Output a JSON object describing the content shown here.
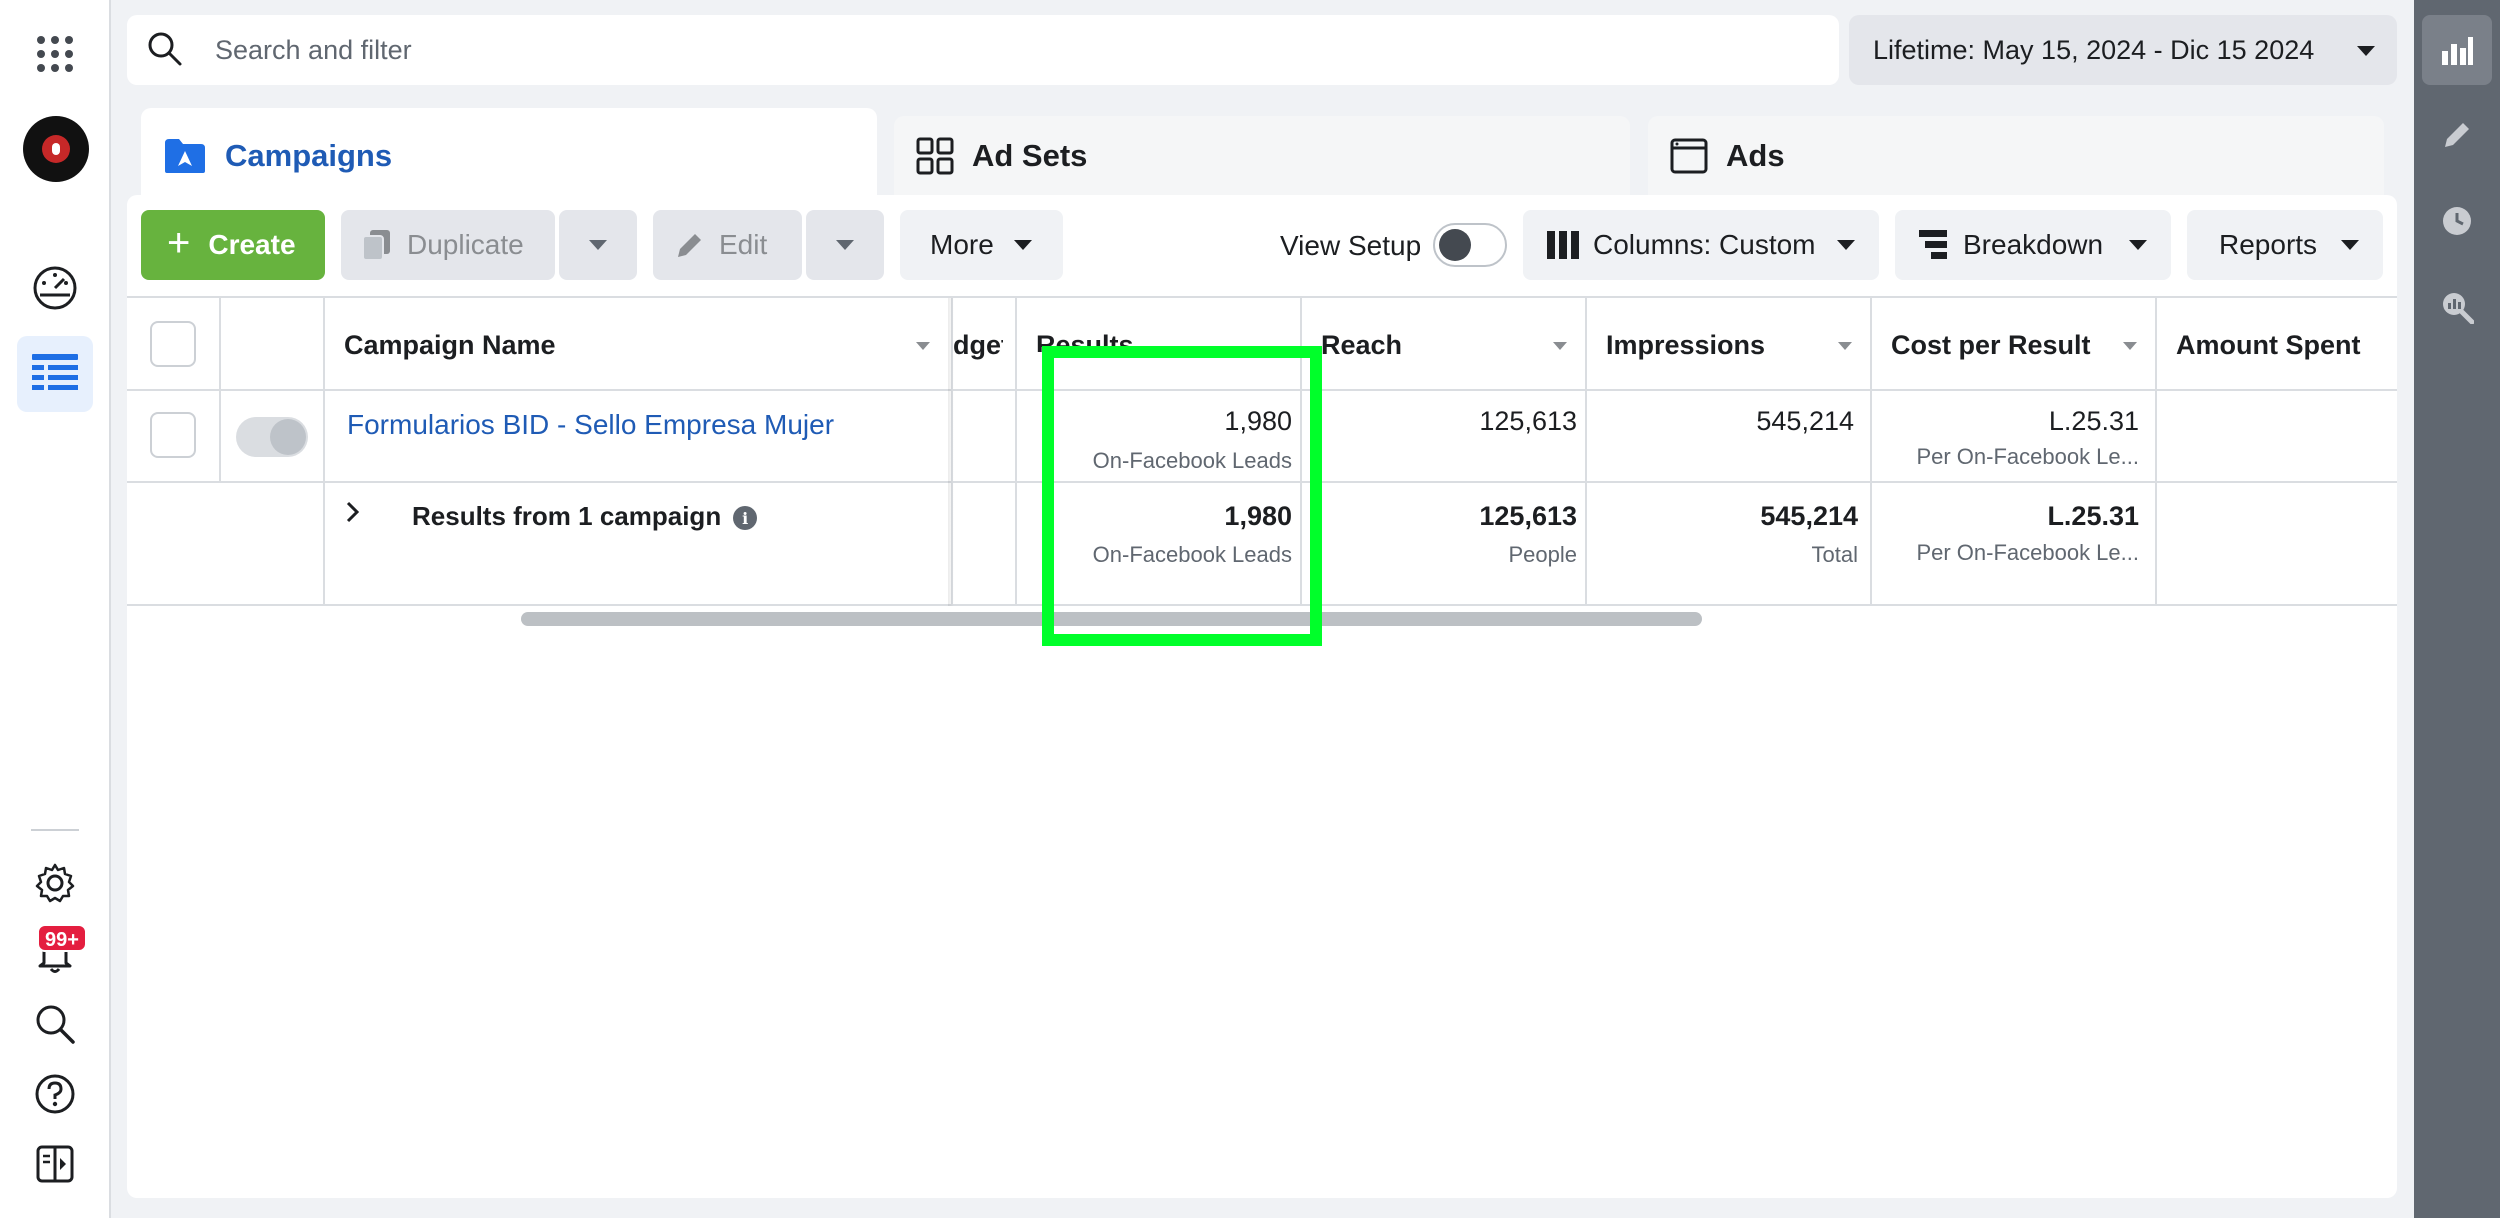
{
  "search": {
    "placeholder": "Search and filter"
  },
  "date_range": {
    "label": "Lifetime: May 15, 2024 - Dic 15 2024"
  },
  "tabs": [
    {
      "label": "Campaigns",
      "icon": "folder-icon",
      "active": true
    },
    {
      "label": "Ad Sets",
      "icon": "grid-icon",
      "active": false
    },
    {
      "label": "Ads",
      "icon": "window-icon",
      "active": false
    }
  ],
  "toolbar": {
    "create": "Create",
    "duplicate": "Duplicate",
    "edit": "Edit",
    "more": "More",
    "view_setup": "View Setup",
    "columns": "Columns: Custom",
    "breakdown": "Breakdown",
    "reports": "Reports"
  },
  "table": {
    "headers": {
      "campaign_name": "Campaign Name",
      "budget": "dget",
      "results": "Results",
      "reach": "Reach",
      "impressions": "Impressions",
      "cost_per_result": "Cost per Result",
      "amount_spent": "Amount Spent"
    },
    "row": {
      "campaign_name": "Formularios BID - Sello Empresa Mujer",
      "results": "1,980",
      "results_sub": "On-Facebook Leads",
      "reach": "125,613",
      "impressions": "545,214",
      "cost_per_result": "L.25.31",
      "cost_per_result_sub": "Per On-Facebook Le..."
    },
    "summary": {
      "label": "Results from 1 campaign",
      "results": "1,980",
      "results_sub": "On-Facebook Leads",
      "reach": "125,613",
      "reach_sub": "People",
      "impressions": "545,214",
      "impressions_sub": "Total",
      "cost_per_result": "L.25.31",
      "cost_per_result_sub": "Per On-Facebook Le..."
    }
  },
  "notifications": {
    "badge": "99+"
  },
  "colors": {
    "accent_blue": "#1f5bb5",
    "create_green": "#67b33e",
    "highlight": "#00ff2a",
    "badge_red": "#e41e3f"
  }
}
